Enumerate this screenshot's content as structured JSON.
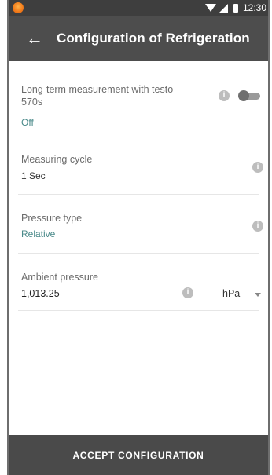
{
  "status_bar": {
    "time": "12:30",
    "icons": [
      "testo-logo-icon",
      "wifi-icon",
      "signal-icon",
      "battery-icon"
    ]
  },
  "app_bar": {
    "back_icon": "←",
    "title": "Configuration of Refrigeration"
  },
  "settings": {
    "long_term": {
      "label": "Long-term measurement with testo 570s",
      "value": "Off",
      "toggle_on": false
    },
    "measuring_cycle": {
      "label": "Measuring cycle",
      "value": "1 Sec"
    },
    "pressure_type": {
      "label": "Pressure type",
      "value": "Relative"
    },
    "ambient_pressure": {
      "label": "Ambient pressure",
      "value": "1,013.25",
      "unit": "hPa"
    }
  },
  "info_glyph": "i",
  "footer": {
    "accept_label": "ACCEPT CONFIGURATION"
  },
  "colors": {
    "app_bar": "#4d4d4d",
    "status_bar": "#3e3e3e",
    "value_green": "#4a8a8a",
    "footer": "#4a4a4a"
  }
}
